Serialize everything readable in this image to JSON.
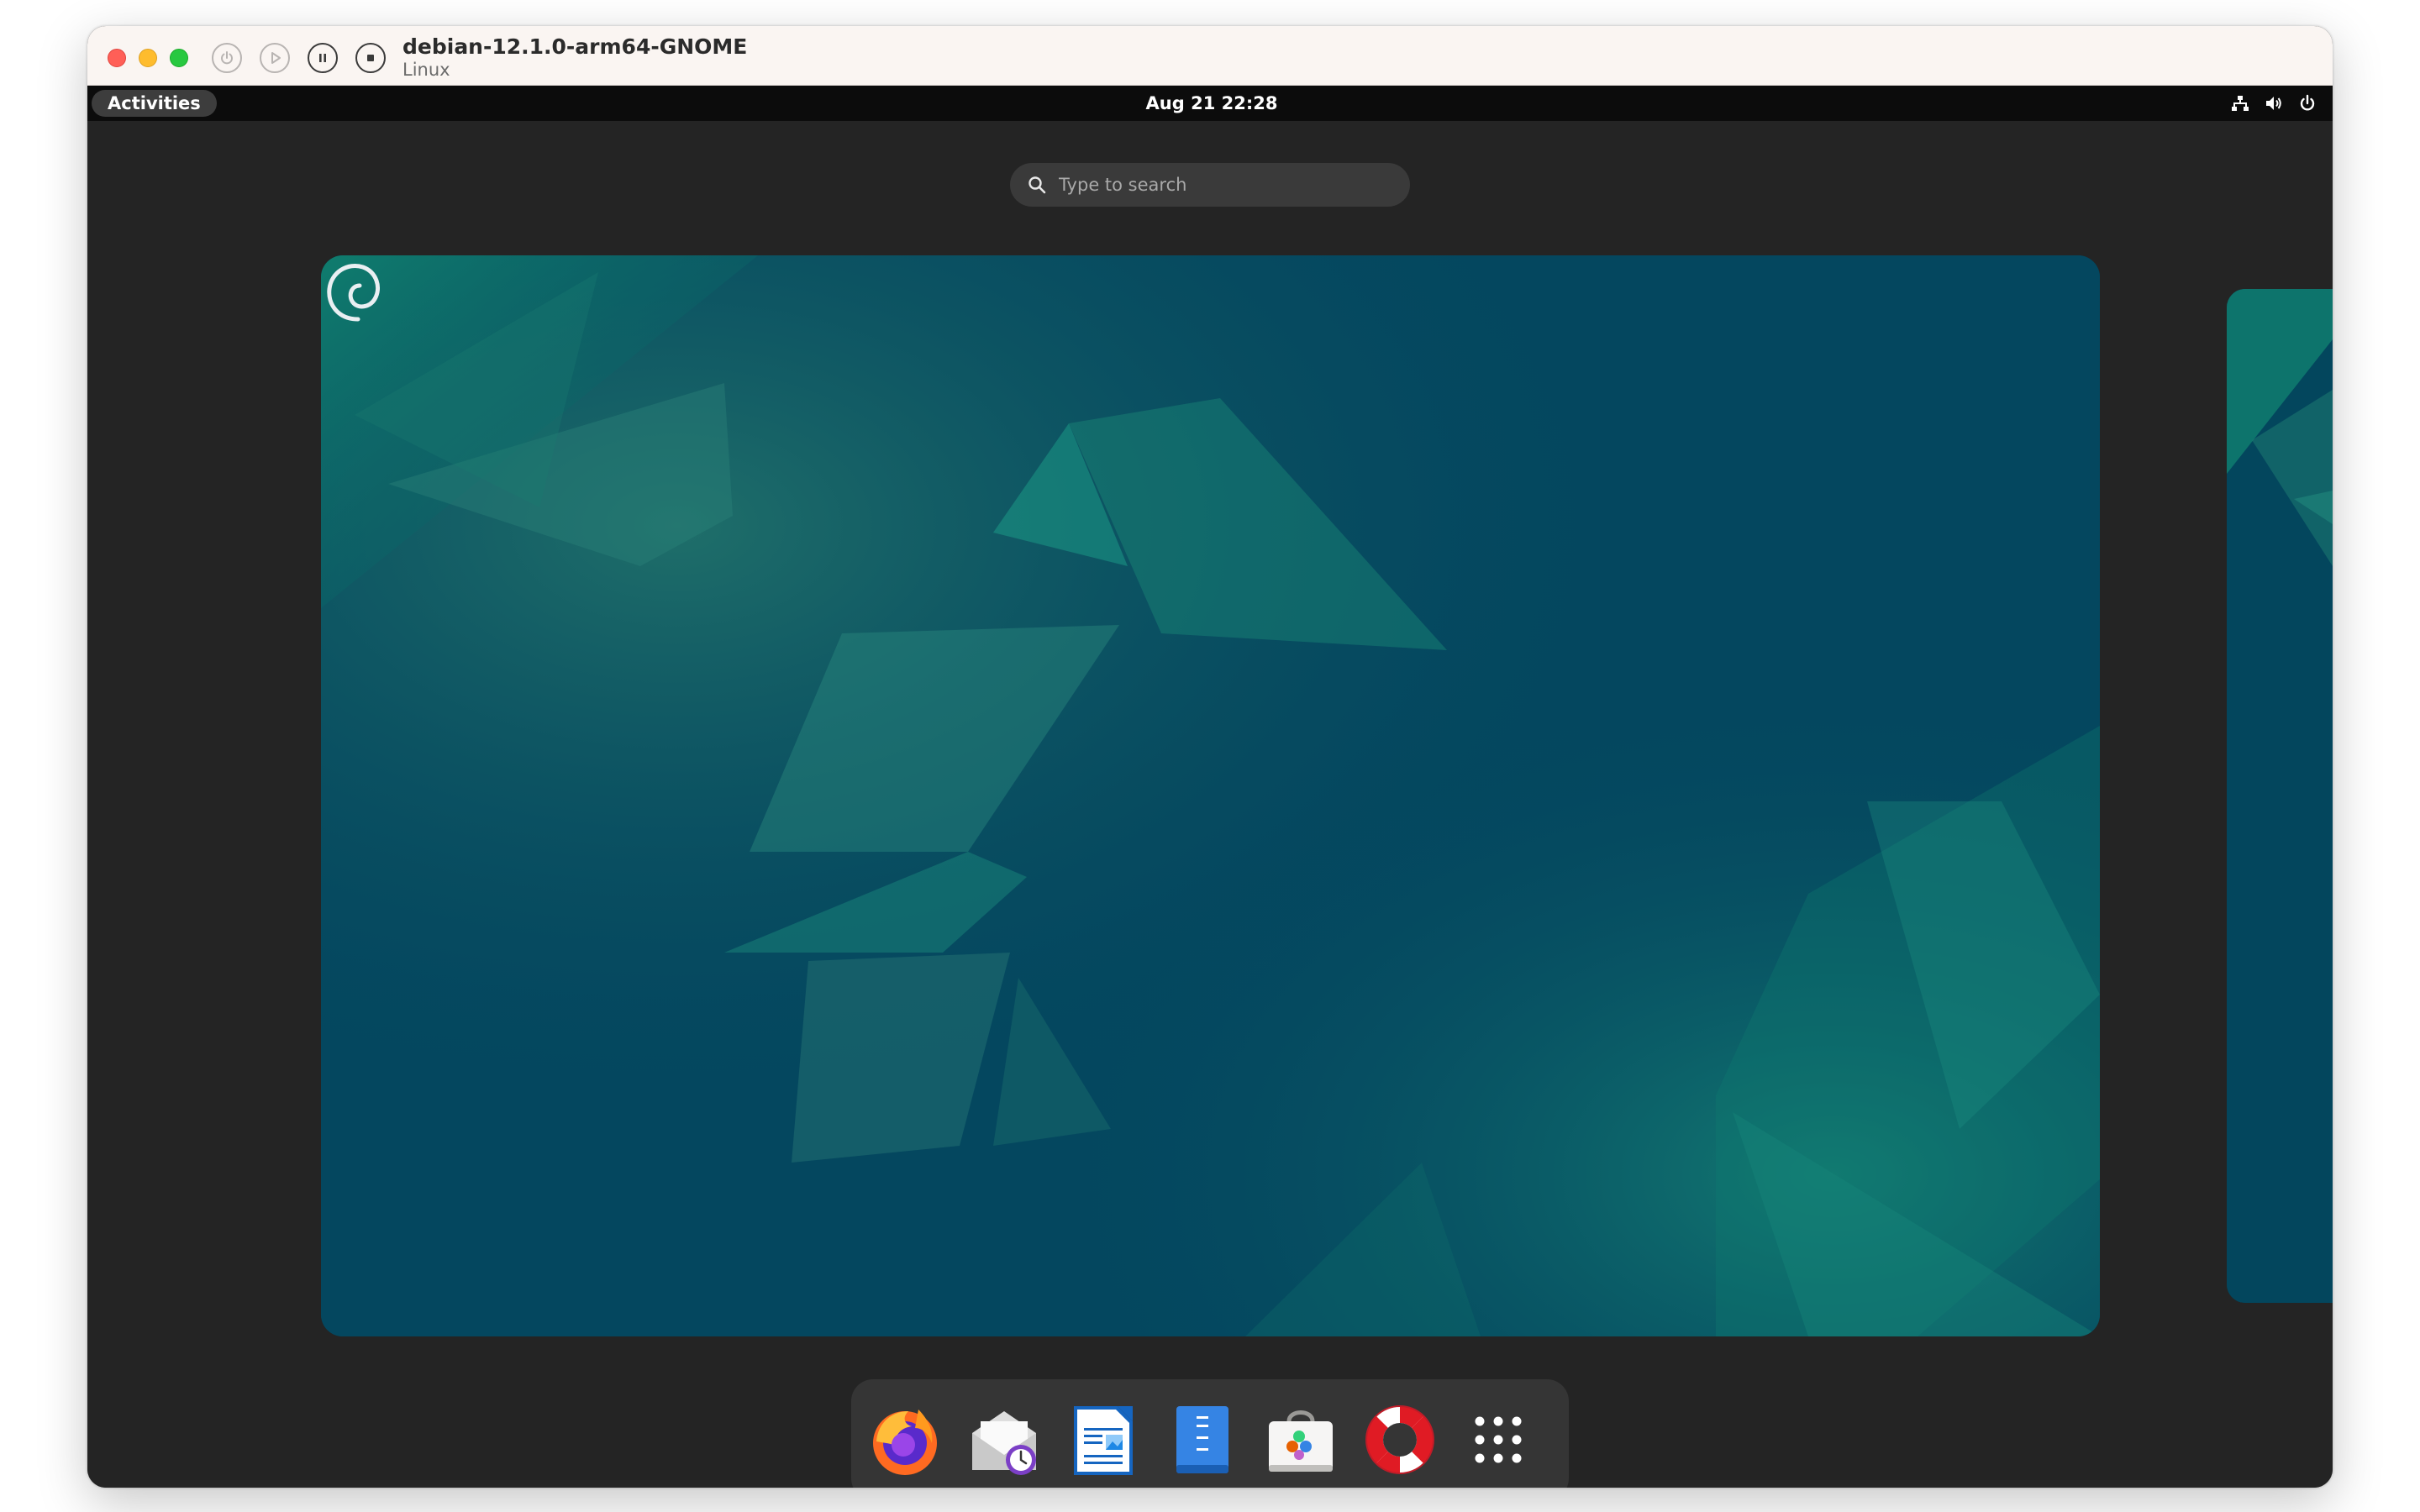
{
  "vm": {
    "title": "debian-12.1.0-arm64-GNOME",
    "subtitle": "Linux"
  },
  "topbar": {
    "activities_label": "Activities",
    "clock": "Aug 21  22:28",
    "tray_icons": [
      "network-icon",
      "volume-icon",
      "power-icon"
    ]
  },
  "search": {
    "placeholder": "Type to search"
  },
  "dash": {
    "apps": [
      {
        "name": "firefox-icon"
      },
      {
        "name": "evolution-mail-icon"
      },
      {
        "name": "libreoffice-writer-icon"
      },
      {
        "name": "file-roller-icon"
      },
      {
        "name": "software-store-icon"
      },
      {
        "name": "help-lifebuoy-icon"
      },
      {
        "name": "show-apps-grid-icon"
      }
    ]
  },
  "colors": {
    "desktop_bg": "#242424",
    "topbar_bg": "#0c0c0c",
    "wallpaper_base": "#04475f",
    "wallpaper_accent": "#17907a",
    "dash_bg": "#353535"
  }
}
